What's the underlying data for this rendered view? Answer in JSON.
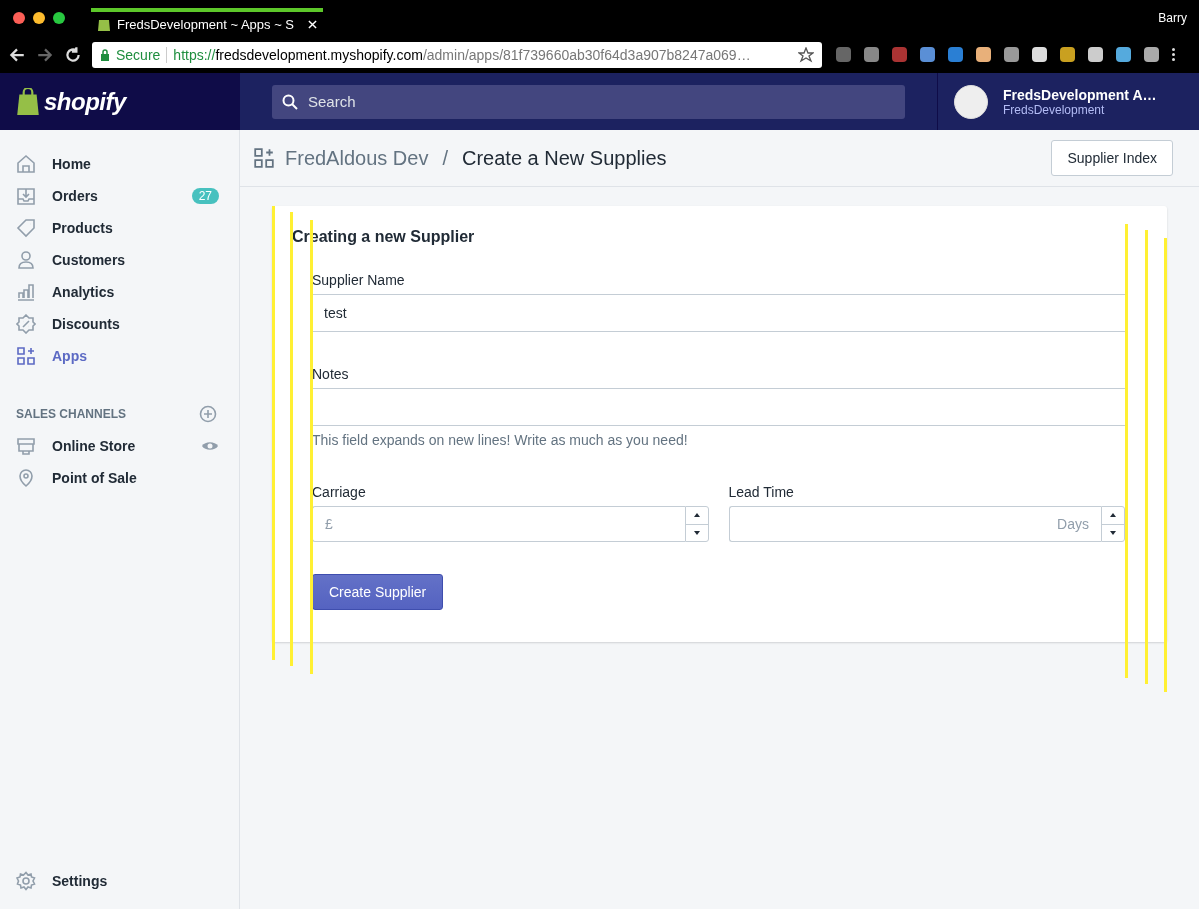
{
  "browser": {
    "tab_title": "FredsDevelopment ~ Apps ~ S",
    "profile": "Barry",
    "secure_label": "Secure",
    "url_scheme": "https://",
    "url_host": "fredsdevelopment.myshopify.com",
    "url_path": "/admin/apps/81f739660ab30f64d3a907b8247a069…"
  },
  "topbar": {
    "logo": "shopify",
    "search": {
      "placeholder": "Search"
    },
    "account": {
      "name": "FredsDevelopment A…",
      "store": "FredsDevelopment"
    }
  },
  "sidebar": {
    "items": [
      {
        "label": "Home",
        "selected": false
      },
      {
        "label": "Orders",
        "selected": false,
        "badge": "27"
      },
      {
        "label": "Products",
        "selected": false
      },
      {
        "label": "Customers",
        "selected": false
      },
      {
        "label": "Analytics",
        "selected": false
      },
      {
        "label": "Discounts",
        "selected": false
      },
      {
        "label": "Apps",
        "selected": true
      }
    ],
    "section_title": "SALES CHANNELS",
    "channels": [
      {
        "label": "Online Store",
        "selected": false
      },
      {
        "label": "Point of Sale",
        "selected": false
      }
    ],
    "settings": "Settings"
  },
  "header": {
    "app": "FredAldous Dev",
    "separator": "/",
    "title": "Create a New Supplies",
    "button": "Supplier Index"
  },
  "form": {
    "title": "Creating a new Supplier",
    "supplier_name": {
      "label": "Supplier Name",
      "value": "test"
    },
    "notes": {
      "label": "Notes",
      "help": "This field expands on new lines! Write as much as you need!"
    },
    "carriage": {
      "label": "Carriage",
      "placeholder": "£"
    },
    "lead_time": {
      "label": "Lead Time",
      "placeholder": "Days"
    },
    "submit": "Create Supplier"
  }
}
